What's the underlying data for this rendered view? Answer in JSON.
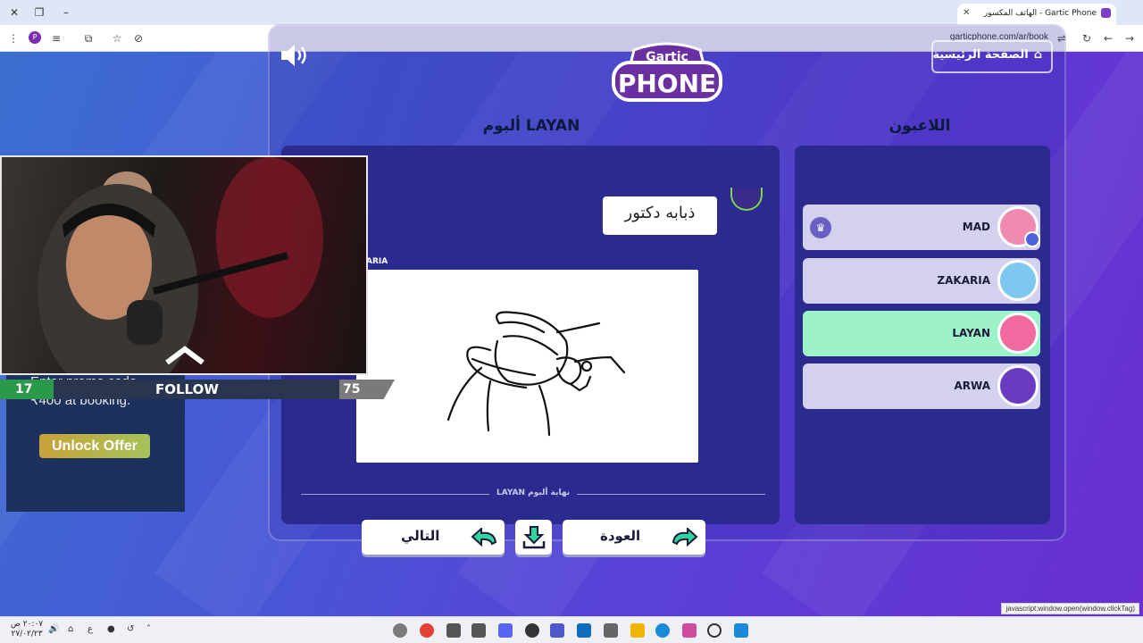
{
  "browser": {
    "tab_title": "Gartic Phone - الهاتف المكسور",
    "url": "garticphone.com/ar/book",
    "status_url": "javascript:window.open(window.clickTag)",
    "profile_initial": "P"
  },
  "game": {
    "home_button": "الصفحة الرئيسية",
    "logo_top": "Gartic",
    "logo_main": "PHONE",
    "album_title": "ألبوم LAYAN",
    "players_title": "اللاعبون",
    "caption": "ذبابه دكتور",
    "drawer_label": "ARIA",
    "end_label": "نهاية ألبوم LAYAN",
    "next_button": "التالي",
    "back_button": "العودة",
    "players": [
      {
        "name": "MAD",
        "host": true,
        "active": false,
        "avatar_color": "#f08ab0"
      },
      {
        "name": "ZAKARIA",
        "host": false,
        "active": false,
        "avatar_color": "#7ec8f0"
      },
      {
        "name": "LAYAN",
        "host": false,
        "active": true,
        "avatar_color": "#f06aa0"
      },
      {
        "name": "ARWA",
        "host": false,
        "active": false,
        "avatar_color": "#6a3ac0"
      }
    ]
  },
  "overlay": {
    "ad_text_line1": "Enter promo code",
    "ad_text_line2": "₹400 at booking.",
    "unlock_button": "Unlock Offer",
    "follow_label": "FOLLOW",
    "follow_current": "17",
    "follow_goal": "75"
  },
  "taskbar": {
    "time": "٢٠:٠٧ ص",
    "date": "٢٧/٠٢/٢٣",
    "lang": "ع"
  }
}
